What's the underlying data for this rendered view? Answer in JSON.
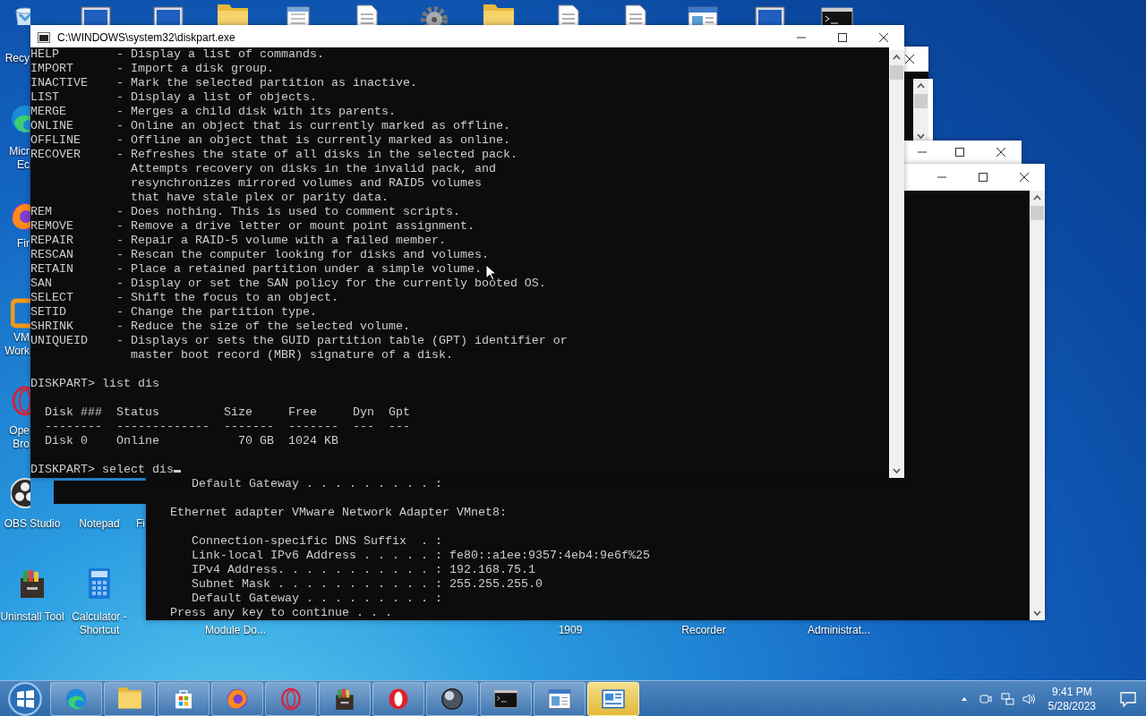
{
  "desktop_icons": [
    {
      "kind": "bin",
      "label_lines": [
        "Recy"
      ]
    },
    {
      "kind": "monitor"
    },
    {
      "kind": "monitor"
    },
    {
      "kind": "folder"
    },
    {
      "kind": "notepad"
    },
    {
      "kind": "document"
    },
    {
      "kind": "gear"
    },
    {
      "kind": "folder"
    },
    {
      "kind": "document"
    },
    {
      "kind": "document"
    },
    {
      "kind": "window"
    },
    {
      "kind": "monitor"
    },
    {
      "kind": "terminal"
    },
    {
      "kind": "swirl",
      "label_lines": [
        "Micr",
        "Ec"
      ]
    },
    {
      "kind": "flame",
      "label_lines": [
        "Fir"
      ]
    },
    {
      "kind": "square",
      "label_lines": [
        "VM",
        "Work"
      ]
    },
    {
      "kind": "ring",
      "label_lines": [
        "Ope",
        "Bro"
      ]
    },
    {
      "kind": "obs",
      "label_lines": [
        "OBS Studio"
      ]
    },
    {
      "label_lines": [
        "Notepad"
      ]
    },
    {
      "label_lines": [
        "Fi"
      ]
    },
    {
      "kind": "cabinet",
      "label_lines": [
        "Uninstall Tool"
      ]
    },
    {
      "kind": "calculator",
      "label_lines": [
        "Calculator -",
        "Shortcut"
      ]
    },
    {
      "label_lines": [
        "Module Do..."
      ]
    },
    {
      "label_lines": [
        "1909"
      ]
    },
    {
      "label_lines": [
        "Recorder"
      ]
    },
    {
      "label_lines": [
        "Administrat..."
      ]
    }
  ],
  "back_console": {
    "blocks": [
      [
        "   Default Gateway . . . . . . . . . :"
      ],
      [
        "Ethernet adapter VMware Network Adapter VMnet8:"
      ],
      [
        "   Connection-specific DNS Suffix  . :",
        "   Link-local IPv6 Address . . . . . : fe80::a1ee:9357:4eb4:9e6f%25",
        "   IPv4 Address. . . . . . . . . . . : 192.168.75.1",
        "   Subnet Mask . . . . . . . . . . . : 255.255.255.0",
        "   Default Gateway . . . . . . . . . :",
        "Press any key to continue . . ."
      ]
    ]
  },
  "window": {
    "title": "C:\\WINDOWS\\system32\\diskpart.exe"
  },
  "console": {
    "cursor_visible": true,
    "blocks": [
      [
        "HELP        - Display a list of commands.",
        "IMPORT      - Import a disk group.",
        "INACTIVE    - Mark the selected partition as inactive.",
        "LIST        - Display a list of objects.",
        "MERGE       - Merges a child disk with its parents.",
        "ONLINE      - Online an object that is currently marked as offline.",
        "OFFLINE     - Offline an object that is currently marked as online.",
        "RECOVER     - Refreshes the state of all disks in the selected pack.",
        "              Attempts recovery on disks in the invalid pack, and",
        "              resynchronizes mirrored volumes and RAID5 volumes",
        "              that have stale plex or parity data.",
        "REM         - Does nothing. This is used to comment scripts.",
        "REMOVE      - Remove a drive letter or mount point assignment.",
        "REPAIR      - Repair a RAID-5 volume with a failed member.",
        "RESCAN      - Rescan the computer looking for disks and volumes.",
        "RETAIN      - Place a retained partition under a simple volume.",
        "SAN         - Display or set the SAN policy for the currently booted OS.",
        "SELECT      - Shift the focus to an object.",
        "SETID       - Change the partition type.",
        "SHRINK      - Reduce the size of the selected volume.",
        "UNIQUEID    - Displays or sets the GUID partition table (GPT) identifier or",
        "              master boot record (MBR) signature of a disk."
      ],
      [
        "DISKPART> list dis"
      ],
      [
        "  Disk ###  Status         Size     Free     Dyn  Gpt",
        "  --------  -------------  -------  -------  ---  ---",
        "  Disk 0    Online           70 GB  1024 KB"
      ],
      [
        "DISKPART> select dis"
      ]
    ]
  },
  "taskbar": {
    "items": [
      {
        "kind": "swirl",
        "selected": false
      },
      {
        "kind": "folder",
        "selected": false
      },
      {
        "kind": "store",
        "selected": false
      },
      {
        "kind": "flame",
        "selected": false
      },
      {
        "kind": "ring",
        "selected": false
      },
      {
        "kind": "cabinet",
        "selected": false
      },
      {
        "kind": "opera",
        "selected": false
      },
      {
        "kind": "sphere",
        "selected": false
      },
      {
        "kind": "terminal",
        "selected": false
      },
      {
        "kind": "window",
        "selected": false
      },
      {
        "kind": "panel",
        "selected": true
      }
    ]
  },
  "tray": {
    "icons": [
      {
        "kind": "caret"
      },
      {
        "kind": "camera"
      },
      {
        "kind": "network"
      },
      {
        "kind": "speaker"
      }
    ],
    "time": "9:41 PM",
    "date": "5/28/2023"
  }
}
